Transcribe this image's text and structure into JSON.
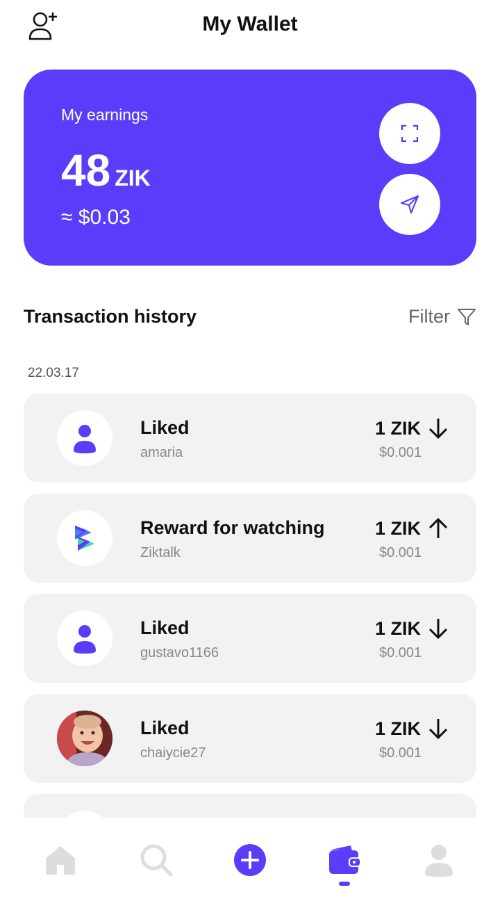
{
  "header": {
    "title": "My Wallet",
    "add_user_icon": "add-user-icon"
  },
  "card": {
    "label": "My earnings",
    "amount": "48",
    "unit": "ZIK",
    "usd": "≈ $0.03",
    "background": "#5a3dfb",
    "scan_icon": "scan-icon",
    "send_icon": "send-icon"
  },
  "history": {
    "title": "Transaction history",
    "filter_label": "Filter",
    "date": "22.03.17"
  },
  "transactions": [
    {
      "title": "Liked",
      "user": "amaria",
      "amount": "1 ZIK",
      "usd": "$0.001",
      "direction": "down",
      "avatar": "default-user-avatar"
    },
    {
      "title": "Reward for watching",
      "user": "Ziktalk",
      "amount": "1 ZIK",
      "usd": "$0.001",
      "direction": "up",
      "avatar": "ziktalk-logo"
    },
    {
      "title": "Liked",
      "user": "gustavo1166",
      "amount": "1 ZIK",
      "usd": "$0.001",
      "direction": "down",
      "avatar": "default-user-avatar"
    },
    {
      "title": "Liked",
      "user": "chaiycie27",
      "amount": "1 ZIK",
      "usd": "$0.001",
      "direction": "down",
      "avatar": "photo-avatar"
    }
  ],
  "nav": {
    "items": [
      "home-icon",
      "search-icon",
      "create-icon",
      "wallet-icon",
      "profile-icon"
    ],
    "active": "wallet-icon",
    "accent": "#5a3dfb"
  }
}
